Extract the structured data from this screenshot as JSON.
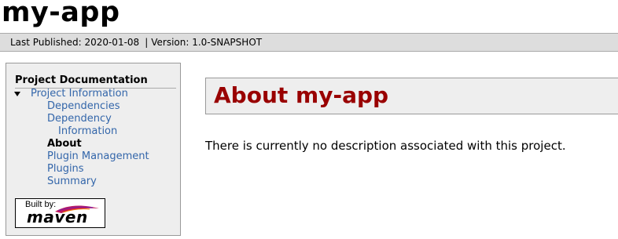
{
  "banner": {
    "title": "my-app"
  },
  "breadcrumbs": {
    "published_label": "Last Published: 2020-01-08",
    "separator": "|",
    "version_label": "Version: 1.0-SNAPSHOT"
  },
  "navigation": {
    "heading": "Project Documentation",
    "project_information": "Project Information",
    "items": [
      {
        "label": "Dependencies"
      },
      {
        "label_line1": "Dependency",
        "label_line2": "Information"
      },
      {
        "label": "About",
        "current": true
      },
      {
        "label": "Plugin Management"
      },
      {
        "label": "Plugins"
      },
      {
        "label": "Summary"
      }
    ]
  },
  "powered_by": {
    "built_by": "Built by:",
    "tool": "maven"
  },
  "main": {
    "title": "About my-app",
    "description": "There is currently no description associated with this project."
  },
  "colors": {
    "title_red": "#990000",
    "link_blue": "#3366aa",
    "breadcrumb_bg": "#dddddd",
    "panel_bg": "#eeeeee"
  }
}
